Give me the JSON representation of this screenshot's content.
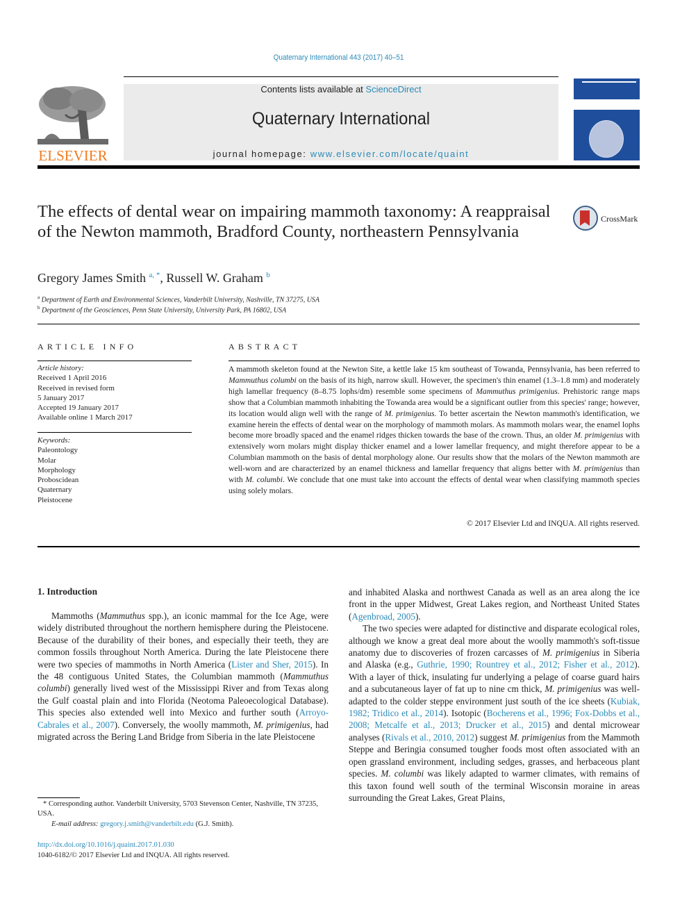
{
  "header": {
    "journal_reference": "Quaternary International 443 (2017) 40–51",
    "contents_prefix": "Contents lists available at ",
    "contents_link": "ScienceDirect",
    "journal_name": "Quaternary International",
    "homepage_prefix": "journal homepage: ",
    "homepage_link": "www.elsevier.com/locate/quaint",
    "publisher_logo_text": "ELSEVIER",
    "colors": {
      "link": "#2a8ab8",
      "elsevier_orange": "#f07a1e",
      "cover_blue": "#1f4f9c",
      "banner_gray": "#ebebeb"
    }
  },
  "article": {
    "title": "The effects of dental wear on impairing mammoth taxonomy: A reappraisal of the Newton mammoth, Bradford County, northeastern Pennsylvania",
    "crossmark_label": "CrossMark",
    "authors": [
      {
        "name": "Gregory James Smith",
        "marks": "a, *"
      },
      {
        "name": "Russell W. Graham",
        "marks": "b"
      }
    ],
    "affiliations": [
      {
        "mark": "a",
        "text": "Department of Earth and Environmental Sciences, Vanderbilt University, Nashville, TN 37275, USA"
      },
      {
        "mark": "b",
        "text": "Department of the Geosciences, Penn State University, University Park, PA 16802, USA"
      }
    ]
  },
  "article_info": {
    "heading": "ARTICLE INFO",
    "history_label": "Article history:",
    "history": [
      "Received 1 April 2016",
      "Received in revised form",
      "5 January 2017",
      "Accepted 19 January 2017",
      "Available online 1 March 2017"
    ],
    "keywords_label": "Keywords:",
    "keywords": [
      "Paleontology",
      "Molar",
      "Morphology",
      "Proboscidean",
      "Quaternary",
      "Pleistocene"
    ]
  },
  "abstract": {
    "heading": "ABSTRACT",
    "segments": [
      {
        "t": "A mammoth skeleton found at the Newton Site, a kettle lake 15 km southeast of Towanda, Pennsylvania, has been referred to "
      },
      {
        "t": "Mammuthus columbi",
        "i": true
      },
      {
        "t": " on the basis of its high, narrow skull. However, the specimen's thin enamel (1.3–1.8 mm) and moderately high lamellar frequency (8–8.75 lophs/dm) resemble some specimens of "
      },
      {
        "t": "Mammuthus primigenius",
        "i": true
      },
      {
        "t": ". Prehistoric range maps show that a Columbian mammoth inhabiting the Towanda area would be a significant outlier from this species' range; however, its location would align well with the range of "
      },
      {
        "t": "M. primigenius",
        "i": true
      },
      {
        "t": ". To better ascertain the Newton mammoth's identi­fication, we examine herein the effects of dental wear on the morphology of mammoth molars. As mammoth molars wear, the enamel lophs become more broadly spaced and the enamel ridges thicken towards the base of the crown. Thus, an older "
      },
      {
        "t": "M. primigenius",
        "i": true
      },
      {
        "t": " with extensively worn molars might display thicker enamel and a lower lamellar frequency, and might therefore appear to be a Columbian mammoth on the basis of dental morphology alone. Our results show that the molars of the Newton mammoth are well-worn and are characterized by an enamel thickness and lamellar frequency that aligns better with "
      },
      {
        "t": "M. primigenius",
        "i": true
      },
      {
        "t": " than with "
      },
      {
        "t": "M. columbi",
        "i": true
      },
      {
        "t": ". We conclude that one must take into account the effects of dental wear when classifying mammoth species using solely molars."
      }
    ],
    "copyright": "© 2017 Elsevier Ltd and INQUA. All rights reserved."
  },
  "body": {
    "section_heading": "1.  Introduction",
    "left_column": [
      {
        "t": "Mammoths ("
      },
      {
        "t": "Mammuthus",
        "i": true
      },
      {
        "t": " spp.), an iconic mammal for the Ice Age, were widely distributed throughout the northern hemisphere during the Pleistocene. Because of the durability of their bones, and especially their teeth, they are common fossils throughout North America. During the late Pleistocene there were two species of mammoths in North America ("
      },
      {
        "t": "Lister and Sher, 2015",
        "l": true
      },
      {
        "t": "). In the 48 contiguous United States, the Columbian mammoth ("
      },
      {
        "t": "Mammuthus columbi",
        "i": true
      },
      {
        "t": ") generally lived west of the Mississippi River and from Texas along the Gulf coastal plain and into Florida (Neotoma Paleoecological Database). This species also extended well into Mexico and further south ("
      },
      {
        "t": "Arroyo-Cabrales et al., 2007",
        "l": true
      },
      {
        "t": "). Conversely, the woolly mammoth, "
      },
      {
        "t": "M. primigenius",
        "i": true
      },
      {
        "t": ", had migrated across the Bering Land Bridge from Siberia in the late Pleistocene"
      }
    ],
    "right_column_p1": [
      {
        "t": "and inhabited Alaska and northwest Canada as well as an area along the ice front in the upper Midwest, Great Lakes region, and Northeast United States ("
      },
      {
        "t": "Agenbroad, 2005",
        "l": true
      },
      {
        "t": ")."
      }
    ],
    "right_column_p2": [
      {
        "t": "The two species were adapted for distinctive and disparate ecological roles, although we know a great deal more about the woolly mammoth's soft-tissue anatomy due to discoveries of frozen carcasses of "
      },
      {
        "t": "M. primigenius",
        "i": true
      },
      {
        "t": " in Siberia and Alaska (e.g., "
      },
      {
        "t": "Guthrie, 1990; Rountrey et al., 2012; Fisher et al., 2012",
        "l": true
      },
      {
        "t": "). With a layer of thick, insulating fur underlying a pelage of coarse guard hairs and a subcutaneous layer of fat up to nine cm thick, "
      },
      {
        "t": "M. primigenius",
        "i": true
      },
      {
        "t": " was well-adapted to the colder steppe environment just south of the ice sheets ("
      },
      {
        "t": "Kubiak, 1982; Tridico et al., 2014",
        "l": true
      },
      {
        "t": "). Isotopic ("
      },
      {
        "t": "Bocherens et al., 1996; Fox-Dobbs et al., 2008; Metcalfe et al., 2013; Drucker et al., 2015",
        "l": true
      },
      {
        "t": ") and dental microwear analyses ("
      },
      {
        "t": "Rivals et al., 2010, 2012",
        "l": true
      },
      {
        "t": ") suggest "
      },
      {
        "t": "M. primigenius",
        "i": true
      },
      {
        "t": " from the Mammoth Steppe and Beringia consumed tougher foods most often associated with an open grassland environment, including sedges, grasses, and herbaceous plant species. "
      },
      {
        "t": "M. columbi",
        "i": true
      },
      {
        "t": " was likely adapted to warmer climates, with remains of this taxon found well south of the terminal Wis­consin moraine in areas surrounding the Great Lakes, Great Plains,"
      }
    ]
  },
  "footnote": {
    "corresponding": "* Corresponding author. Vanderbilt University, 5703 Stevenson Center, Nashville, TN 37235, USA.",
    "email_label": "E-mail address: ",
    "email": "gregory.j.smith@vanderbilt.edu",
    "email_suffix": " (G.J. Smith).",
    "doi": "http://dx.doi.org/10.1016/j.quaint.2017.01.030",
    "issn_line": "1040-6182/© 2017 Elsevier Ltd and INQUA. All rights reserved."
  }
}
